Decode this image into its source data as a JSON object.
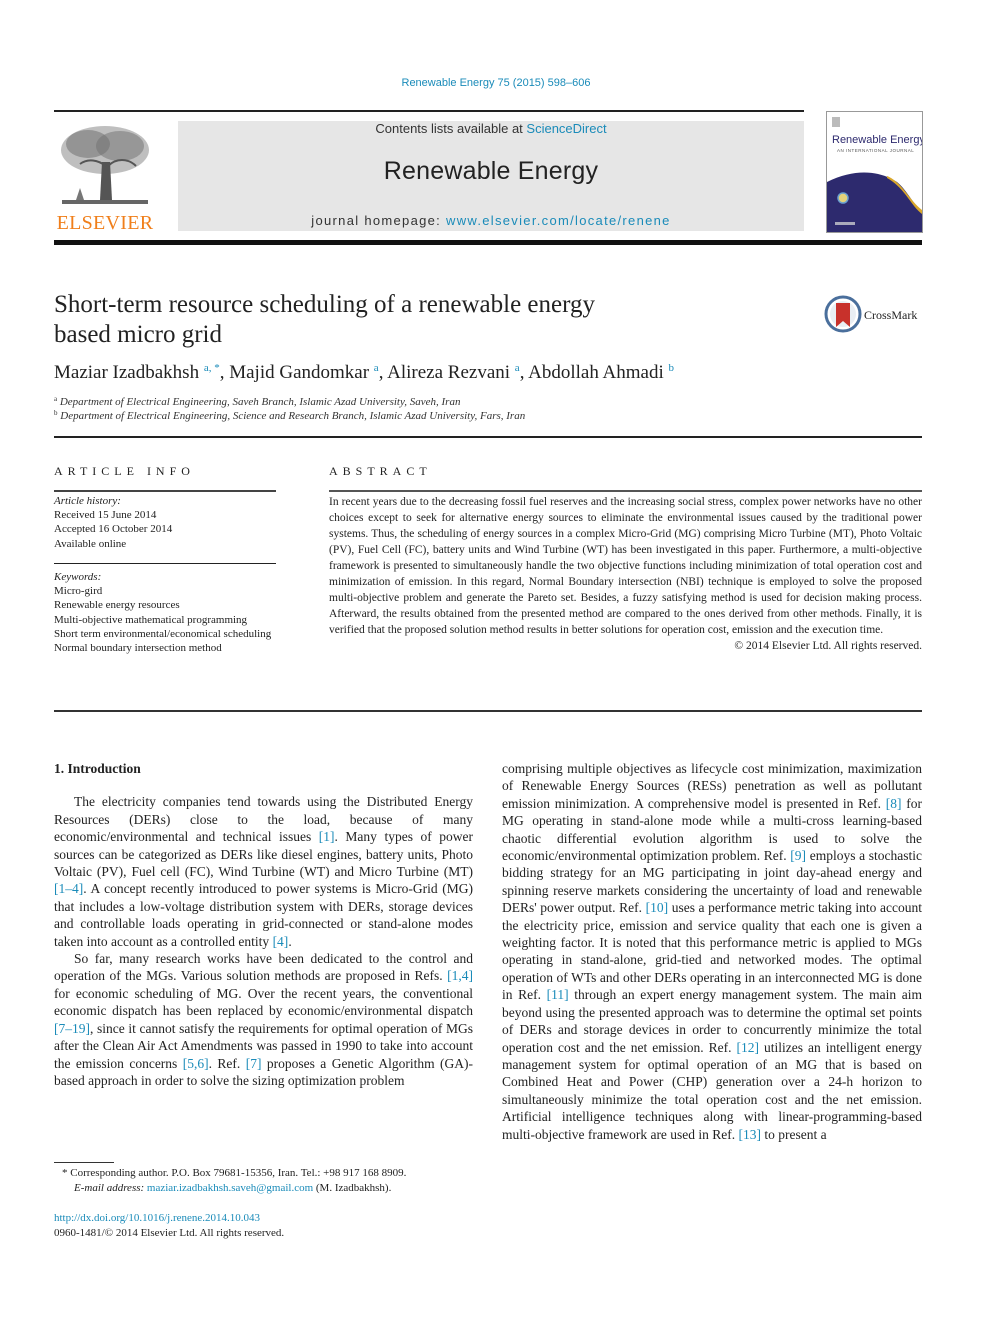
{
  "header": {
    "citation": "Renewable Energy 75 (2015) 598–606",
    "publisher_logo_text": "ELSEVIER",
    "contents_prefix": "Contents lists available at ",
    "contents_link": "ScienceDirect",
    "journal_name": "Renewable Energy",
    "homepage_prefix": "journal homepage: ",
    "homepage_link": "www.elsevier.com/locate/renene",
    "cover_title": "Renewable Energy",
    "cover_subtitle": "AN INTERNATIONAL JOURNAL",
    "colors": {
      "link": "#1a8bb9",
      "elsevier_orange": "#f07f1b",
      "masthead_bg": "#e6e6e6",
      "cover_navy": "#2d2a6e",
      "cover_gold": "#d9a72b"
    }
  },
  "article": {
    "title": "Short-term resource scheduling of a renewable energy based micro grid",
    "crossmark_label": "CrossMark",
    "authors": [
      {
        "name": "Maziar Izadbakhsh",
        "sup": "a, *"
      },
      {
        "name": "Majid Gandomkar",
        "sup": "a"
      },
      {
        "name": "Alireza Rezvani",
        "sup": "a"
      },
      {
        "name": "Abdollah Ahmadi",
        "sup": "b"
      }
    ],
    "affiliations": [
      {
        "mark": "a",
        "text": "Department of Electrical Engineering, Saveh Branch, Islamic Azad University, Saveh, Iran"
      },
      {
        "mark": "b",
        "text": "Department of Electrical Engineering, Science and Research Branch, Islamic Azad University, Fars, Iran"
      }
    ]
  },
  "article_info": {
    "heading": "ARTICLE INFO",
    "history_label": "Article history:",
    "history": [
      "Received 15 June 2014",
      "Accepted 16 October 2014",
      "Available online"
    ],
    "keywords_label": "Keywords:",
    "keywords": [
      "Micro-gird",
      "Renewable energy resources",
      "Multi-objective mathematical programming",
      "Short term environmental/economical scheduling",
      "Normal boundary intersection method"
    ]
  },
  "abstract": {
    "heading": "ABSTRACT",
    "text": "In recent years due to the decreasing fossil fuel reserves and the increasing social stress, complex power networks have no other choices except to seek for alternative energy sources to eliminate the environmental issues caused by the traditional power systems. Thus, the scheduling of energy sources in a complex Micro-Grid (MG) comprising Micro Turbine (MT), Photo Voltaic (PV), Fuel Cell (FC), battery units and Wind Turbine (WT) has been investigated in this paper. Furthermore, a multi-objective framework is presented to simultaneously handle the two objective functions including minimization of total operation cost and minimization of emission. In this regard, Normal Boundary intersection (NBI) technique is employed to solve the proposed multi-objective problem and generate the Pareto set. Besides, a fuzzy satisfying method is used for decision making process. Afterward, the results obtained from the presented method are compared to the ones derived from other methods. Finally, it is verified that the proposed solution method results in better solutions for operation cost, emission and the execution time.",
    "copyright": "© 2014 Elsevier Ltd. All rights reserved."
  },
  "introduction": {
    "heading": "1.  Introduction",
    "left_paragraphs": [
      [
        {
          "t": "The electricity companies tend towards using the Distributed Energy Resources (DERs) close to the load, because of many economic/environmental and technical issues "
        },
        {
          "ref": "[1]"
        },
        {
          "t": ". Many types of power sources can be categorized as DERs like diesel engines, battery units, Photo Voltaic (PV), Fuel cell (FC), Wind Turbine (WT) and Micro Turbine (MT) "
        },
        {
          "ref": "[1–4]"
        },
        {
          "t": ". A concept recently introduced to power systems is Micro-Grid (MG) that includes a low-voltage distribution system with DERs, storage devices and controllable loads operating in grid-connected or stand-alone modes taken into account as a controlled entity "
        },
        {
          "ref": "[4]"
        },
        {
          "t": "."
        }
      ],
      [
        {
          "t": "So far, many research works have been dedicated to the control and operation of the MGs. Various solution methods are proposed in Refs. "
        },
        {
          "ref": "[1,4]"
        },
        {
          "t": " for economic scheduling of MG. Over the recent years, the conventional economic dispatch has been replaced by economic/environmental dispatch "
        },
        {
          "ref": "[7–19]"
        },
        {
          "t": ", since it cannot satisfy the requirements for optimal operation of MGs after the Clean Air Act Amendments was passed in 1990 to take into account the emission concerns "
        },
        {
          "ref": "[5,6]"
        },
        {
          "t": ". Ref. "
        },
        {
          "ref": "[7]"
        },
        {
          "t": " proposes a Genetic Algorithm (GA)-based approach in order to solve the sizing optimization problem"
        }
      ]
    ],
    "right_paragraph": [
      {
        "t": "comprising multiple objectives as lifecycle cost minimization, maximization of Renewable Energy Sources (RESs) penetration as well as pollutant emission minimization. A comprehensive model is presented in Ref. "
      },
      {
        "ref": "[8]"
      },
      {
        "t": " for MG operating in stand-alone mode while a multi-cross learning-based chaotic differential evolution algorithm is used to solve the economic/environmental optimization problem. Ref. "
      },
      {
        "ref": "[9]"
      },
      {
        "t": " employs a stochastic bidding strategy for an MG participating in joint day-ahead energy and spinning reserve markets considering the uncertainty of load and renewable DERs' power output. Ref. "
      },
      {
        "ref": "[10]"
      },
      {
        "t": " uses a performance metric taking into account the electricity price, emission and service quality that each one is given a weighting factor. It is noted that this performance metric is applied to MGs operating in stand-alone, grid-tied and networked modes. The optimal operation of WTs and other DERs operating in an interconnected MG is done in Ref. "
      },
      {
        "ref": "[11]"
      },
      {
        "t": " through an expert energy management system. The main aim beyond using the presented approach was to determine the optimal set points of DERs and storage devices in order to concurrently minimize the total operation cost and the net emission. Ref. "
      },
      {
        "ref": "[12]"
      },
      {
        "t": " utilizes an intelligent energy management system for optimal operation of an MG that is based on Combined Heat and Power (CHP) generation over a 24-h horizon to simultaneously minimize the total operation cost and the net emission. Artificial intelligence techniques along with linear-programming-based multi-objective framework are used in Ref. "
      },
      {
        "ref": "[13]"
      },
      {
        "t": " to present a"
      }
    ]
  },
  "footnote": {
    "marker": "*",
    "corresponding": "Corresponding author. P.O. Box 79681-15356, Iran. Tel.: +98 917 168 8909.",
    "email_label": "E-mail address:",
    "email": "maziar.izadbakhsh.saveh@gmail.com",
    "email_suffix": " (M. Izadbakhsh)."
  },
  "doi": {
    "link": "http://dx.doi.org/10.1016/j.renene.2014.10.043",
    "issn_line": "0960-1481/© 2014 Elsevier Ltd. All rights reserved."
  }
}
